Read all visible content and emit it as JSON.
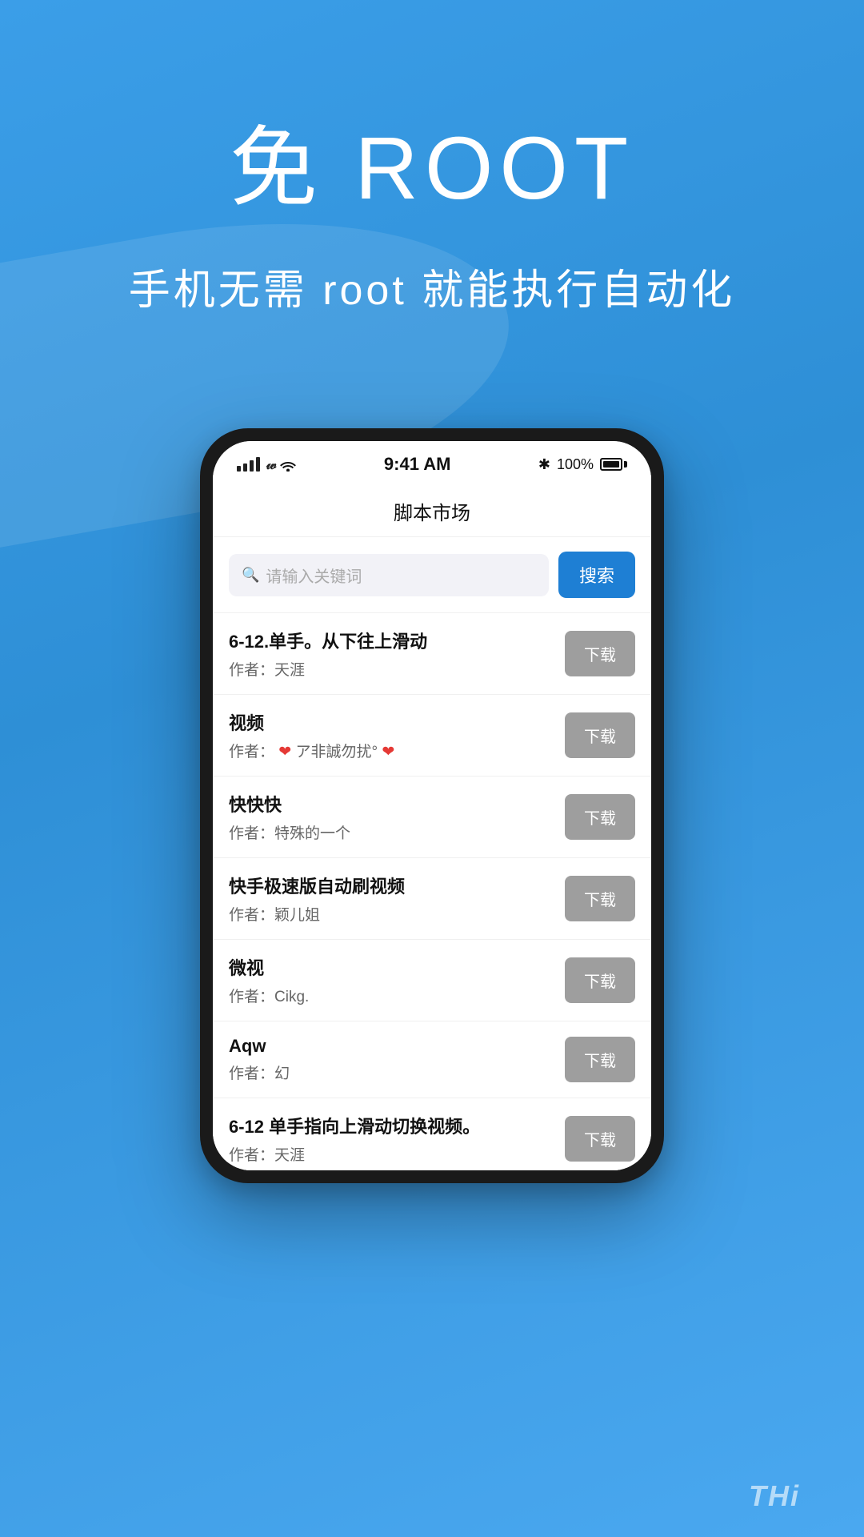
{
  "page": {
    "background": "#3b9ee8",
    "hero": {
      "title": "免 ROOT",
      "subtitle": "手机无需 root 就能执行自动化"
    },
    "bottom_watermark": "THi"
  },
  "phone": {
    "status_bar": {
      "time": "9:41 AM",
      "battery_percent": "100%",
      "bluetooth": "✱"
    },
    "app_header": "脚本市场",
    "search": {
      "placeholder": "请输入关键词",
      "button_label": "搜索"
    },
    "scripts": [
      {
        "name": "6-12.单手。从下往上滑动",
        "author": "作者：天涯",
        "download_label": "下载"
      },
      {
        "name": "视频",
        "author_prefix": "作者：",
        "author_text": "❤ ︎ア非誠勿扰°❤",
        "download_label": "下载"
      },
      {
        "name": "快快快",
        "author": "作者：特殊的一个",
        "download_label": "下载"
      },
      {
        "name": "快手极速版自动刷视频",
        "author": "作者：颖儿姐",
        "download_label": "下载"
      },
      {
        "name": "微视",
        "author": "作者：Cikg.",
        "download_label": "下载"
      },
      {
        "name": "Aqw",
        "author": "作者：幻",
        "download_label": "下载"
      },
      {
        "name": "6-12 单手指向上滑动切换视频。",
        "author": "作者：天涯",
        "download_label": "下载",
        "partial": true
      }
    ]
  }
}
